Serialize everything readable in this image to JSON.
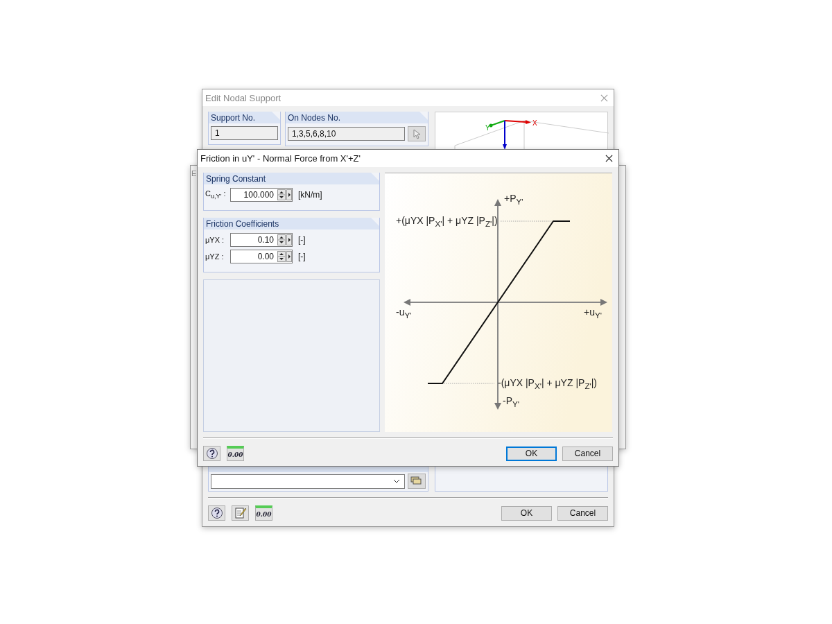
{
  "back_window": {
    "title": "Edit Nodal Support",
    "support_no": {
      "label": "Support No.",
      "value": "1"
    },
    "on_nodes": {
      "label": "On Nodes No.",
      "value": "1,3,5,6,8,10"
    },
    "preview_axes": {
      "x": "X",
      "y": "Y"
    },
    "units_icon": "0.00",
    "buttons": [
      "OK",
      "Cancel"
    ]
  },
  "middle_window": {
    "title": "E"
  },
  "dialog": {
    "title": "Friction in uY' - Normal Force from X'+Z'",
    "groups": [
      {
        "title": "Spring Constant",
        "rows": [
          {
            "label": "C$_{u,Y'}$ :",
            "value": "100.000",
            "unit": "[kN/m]"
          }
        ]
      },
      {
        "title": "Friction Coefficients",
        "rows": [
          {
            "label": "μYX :",
            "value": "0.10",
            "unit": "[-]"
          },
          {
            "label": "μYZ :",
            "value": "0.00",
            "unit": "[-]"
          }
        ]
      }
    ],
    "diagram": {
      "p_plus": "+P$_{Y'}$",
      "p_minus": "-P$_{Y'}$",
      "u_minus": "-u$_{Y'}$",
      "u_plus": "+u$_{Y'}$",
      "upper_limit": "+(μYX |P$_{X'}$| + μYZ |P$_{Z'}$|)",
      "lower_limit": "-(μYX |P$_{X'}$| + μYZ |P$_{Z'}$|)"
    },
    "units_icon": "0.00",
    "buttons": [
      {
        "label": "OK",
        "focused": true
      },
      {
        "label": "Cancel",
        "focused": false
      }
    ]
  }
}
